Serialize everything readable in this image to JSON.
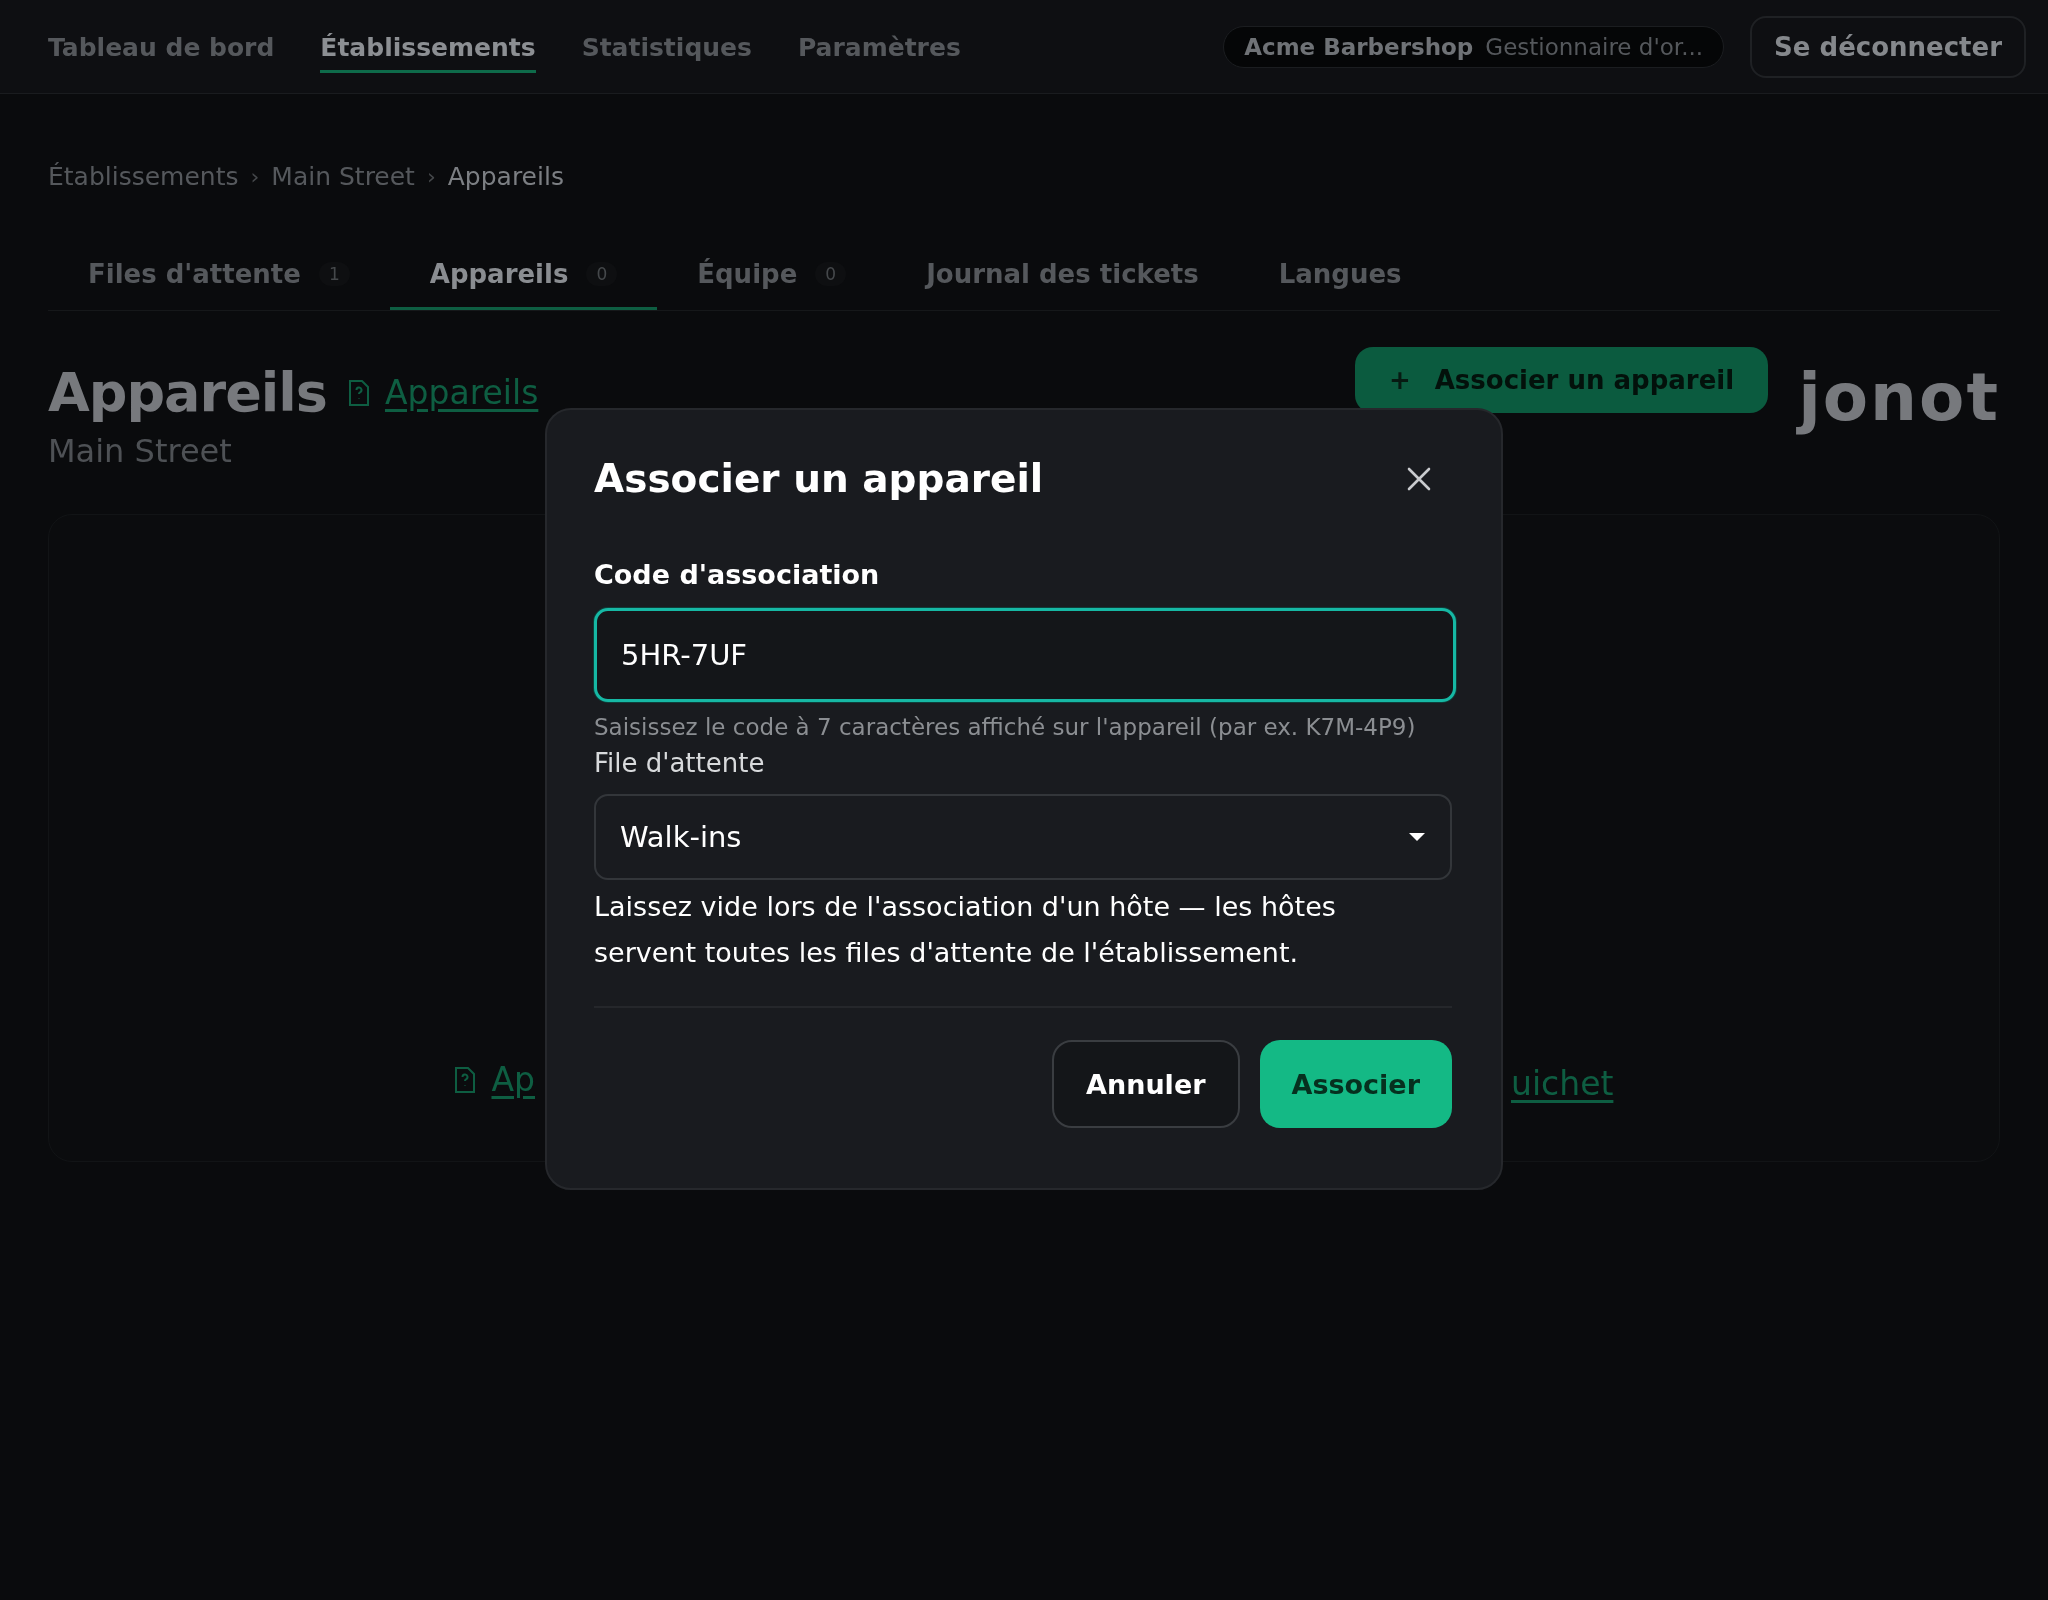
{
  "nav": [
    {
      "label": "Tableau de bord",
      "selected": false
    },
    {
      "label": "Établissements",
      "selected": true
    },
    {
      "label": "Statistiques",
      "selected": false
    },
    {
      "label": "Paramètres",
      "selected": false
    }
  ],
  "account": {
    "business": "Acme Barbershop",
    "role": "Gestionnaire d'or..."
  },
  "logout": "Se déconnecter",
  "breadcrumb": [
    "Établissements",
    "Main Street",
    "Appareils"
  ],
  "breadcrumb_separators": [
    "›",
    "›"
  ],
  "tabs": [
    {
      "label": "Files d'attente",
      "count": "1",
      "selected": false
    },
    {
      "label": "Appareils",
      "count": "0",
      "selected": true
    },
    {
      "label": "Équipe",
      "count": "0",
      "selected": false
    },
    {
      "label": "Journal des tickets",
      "selected": false
    },
    {
      "label": "Langues",
      "selected": false
    }
  ],
  "page": {
    "title": "Appareils",
    "help_link": "Appareils",
    "subtitle": "Main Street",
    "action_icon": "+",
    "action": "Associer un appareil",
    "logo": "jonot"
  },
  "empty_links": [
    "Ap",
    "uichet"
  ],
  "dialog": {
    "title": "Associer un appareil",
    "code_label": "Code d'association",
    "code_value": "5HR-7UF",
    "code_hint": "Saisissez le code à 7 caractères affiché sur l'appareil (par ex. K7M-4P9)",
    "queue_label": "File d'attente",
    "queue_value": "Walk-ins",
    "queue_help": "Laissez vide lors de l'association d'un hôte — les hôtes servent toutes les files d'attente de l'établissement.",
    "buttons": [
      {
        "label": "Annuler",
        "kind": "secondary"
      },
      {
        "label": "Associer",
        "kind": "primary"
      }
    ]
  }
}
